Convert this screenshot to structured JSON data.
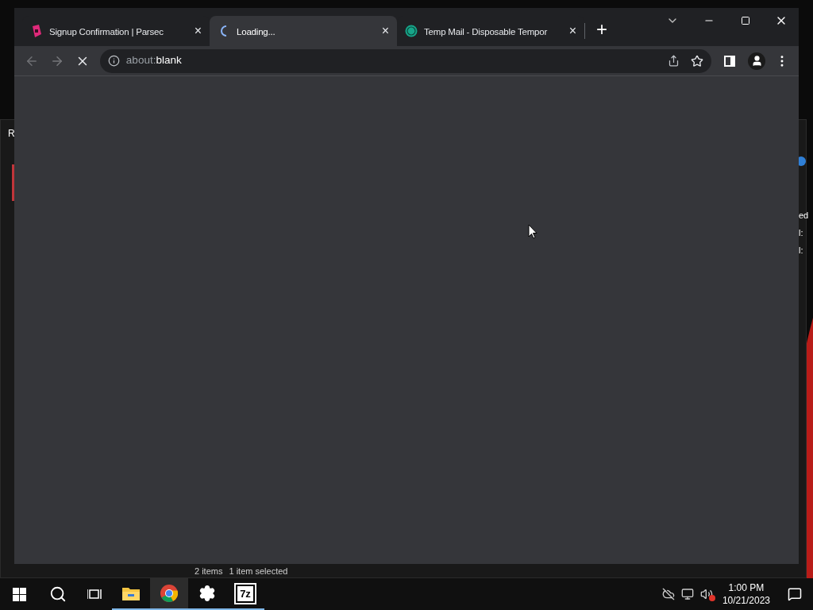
{
  "background_window": {
    "left_text": "R",
    "right_texts": [
      "ed",
      "l:",
      "l:"
    ],
    "status_bar": [
      "2 items",
      "1 item selected"
    ]
  },
  "browser": {
    "tabs": [
      {
        "title": "Signup Confirmation | Parsec",
        "selected": false,
        "loading": false,
        "kind": "parsec",
        "close": "×"
      },
      {
        "title": "Loading...",
        "selected": true,
        "loading": true,
        "kind": "none",
        "close": "×"
      },
      {
        "title": "Temp Mail - Disposable Tempor",
        "selected": false,
        "loading": false,
        "kind": "tempmail",
        "close": "×"
      }
    ],
    "new_tab": "+",
    "toolbar": {
      "back_disabled": true,
      "forward_disabled": true,
      "loading": true,
      "address": {
        "scheme": "about:",
        "rest": "blank"
      }
    }
  },
  "taskbar": {
    "apps": [
      {
        "kind": "explorer",
        "running": true,
        "active": false
      },
      {
        "kind": "chrome",
        "running": true,
        "active": true
      },
      {
        "kind": "settings",
        "running": true,
        "active": false
      },
      {
        "kind": "sevenzip",
        "label": "7z",
        "running": true,
        "active": false
      }
    ],
    "tray": {
      "volume_muted": true
    },
    "clock": {
      "time": "1:00 PM",
      "date": "10/21/2023"
    }
  }
}
